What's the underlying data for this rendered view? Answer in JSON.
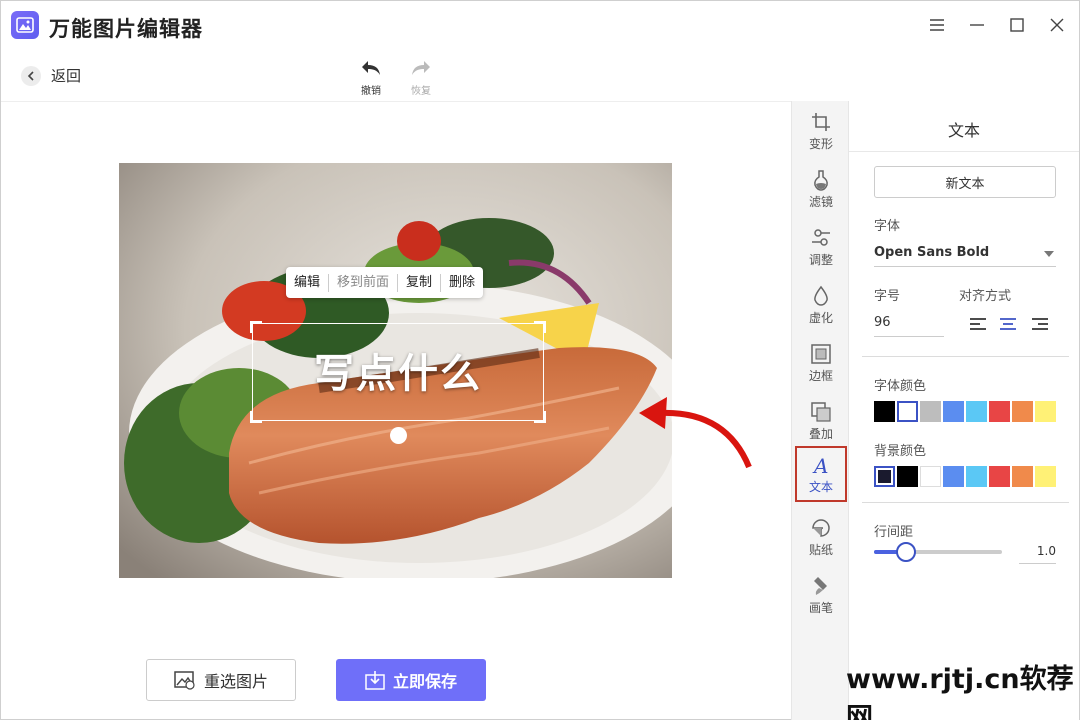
{
  "app": {
    "title": "万能图片编辑器"
  },
  "toolbar": {
    "back_label": "返回",
    "undo_label": "撤销",
    "redo_label": "恢复"
  },
  "canvas": {
    "context_menu": [
      "编辑",
      "移到前面",
      "复制",
      "删除"
    ],
    "text_placeholder": "写点什么"
  },
  "actions": {
    "reselect_label": "重选图片",
    "save_label": "立即保存"
  },
  "rail": {
    "items": [
      {
        "label": "变形",
        "icon": "crop-icon"
      },
      {
        "label": "滤镜",
        "icon": "filter-icon"
      },
      {
        "label": "调整",
        "icon": "adjust-icon"
      },
      {
        "label": "虚化",
        "icon": "blur-icon"
      },
      {
        "label": "边框",
        "icon": "frame-icon"
      },
      {
        "label": "叠加",
        "icon": "overlay-icon"
      },
      {
        "label": "文本",
        "icon": "text-icon",
        "active": true
      },
      {
        "label": "贴纸",
        "icon": "sticker-icon"
      },
      {
        "label": "画笔",
        "icon": "brush-icon"
      }
    ]
  },
  "panel": {
    "title": "文本",
    "new_text_label": "新文本",
    "font_label": "字体",
    "font_value": "Open Sans Bold",
    "size_label": "字号",
    "size_value": "96",
    "align_label": "对齐方式",
    "font_color_label": "字体颜色",
    "bg_color_label": "背景颜色",
    "line_spacing_label": "行间距",
    "line_spacing_value": "1.0",
    "font_colors": [
      "#000000",
      "#ffffff",
      "#bdbdbd",
      "#5b8df0",
      "#5bc8f5",
      "#e84545",
      "#f08a4b",
      "#fff176"
    ],
    "bg_colors": [
      "#1a1a2e",
      "#000000",
      "#ffffff",
      "#5b8df0",
      "#5bc8f5",
      "#e84545",
      "#f08a4b",
      "#fff176"
    ],
    "line_spacing_fraction": 0.25
  },
  "watermark": "www.rjtj.cn软荐网",
  "colors": {
    "accent": "#6f6ff9",
    "active_border": "#c0392b",
    "active_text": "#3b52c4"
  }
}
